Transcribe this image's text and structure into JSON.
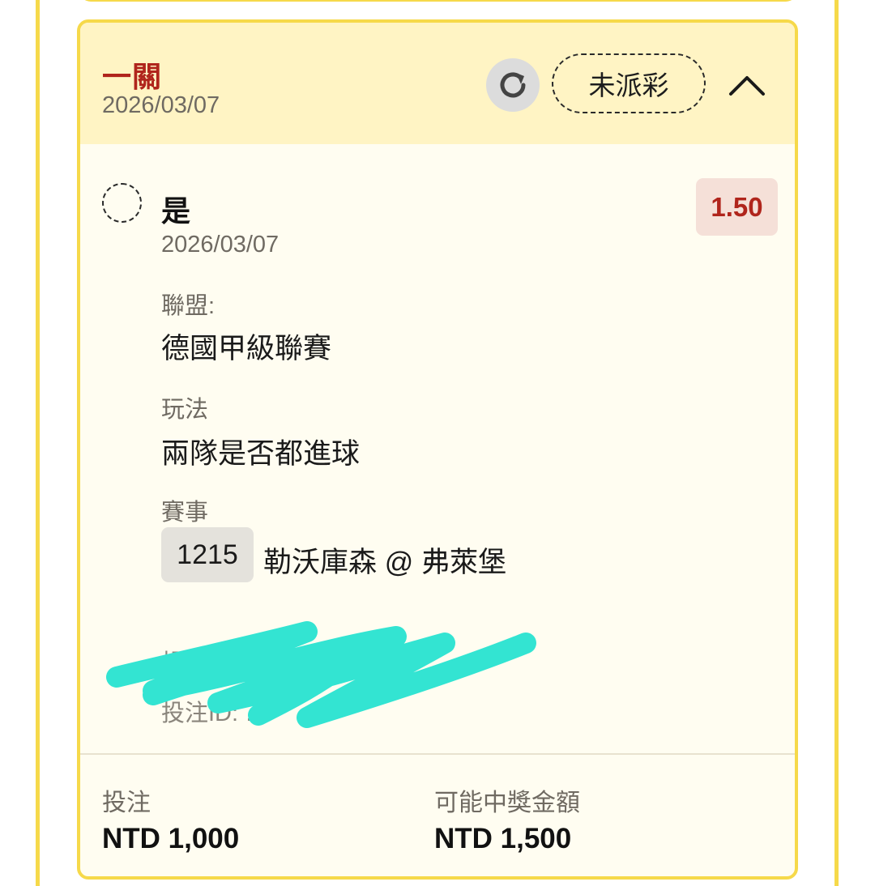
{
  "card": {
    "bet_type": "一關",
    "date": "2026/03/07",
    "status": "未派彩",
    "selection": {
      "label": "是",
      "date": "2026/03/07",
      "odds": "1.50"
    },
    "league": {
      "label": "聯盟:",
      "value": "德國甲級聯賽"
    },
    "market": {
      "label": "玩法",
      "value": "兩隊是否都進球"
    },
    "event": {
      "label": "賽事",
      "match_id": "1215",
      "teams": "勒沃庫森 @ 弗萊堡"
    },
    "redacted": {
      "line1": "投注…",
      "line2": "投注ID:  …"
    },
    "footer": {
      "stake_label": "投注",
      "stake_value": "NTD 1,000",
      "payout_label": "可能中獎金額",
      "payout_value": "NTD 1,500"
    }
  },
  "icons": {
    "refresh": "refresh-icon",
    "collapse": "chevron-up-icon",
    "radio": "dashed-circle-radio"
  },
  "colors": {
    "accent_red": "#b0251c",
    "border_yellow": "#f6d94a",
    "header_bg": "#fff4c4",
    "body_bg": "#fffdf1",
    "scribble": "#33e4d2"
  }
}
